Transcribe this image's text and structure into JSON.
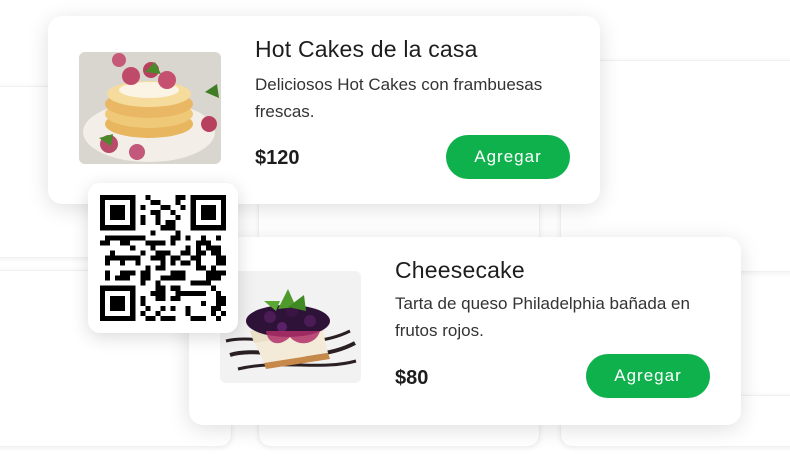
{
  "products": [
    {
      "title": "Hot Cakes de la casa",
      "description": "Deliciosos Hot Cakes con frambuesas frescas.",
      "price": "$120",
      "button_label": "Agregar",
      "image": "pancakes-with-raspberries"
    },
    {
      "title": "Cheesecake",
      "description": "Tarta de queso Philadelphia bañada en frutos rojos.",
      "price": "$80",
      "button_label": "Agregar",
      "image": "cheesecake-with-berries"
    }
  ],
  "qr": {
    "icon": "qr-code-icon"
  },
  "colors": {
    "accent": "#0fb14d",
    "background": "#ffffff"
  }
}
